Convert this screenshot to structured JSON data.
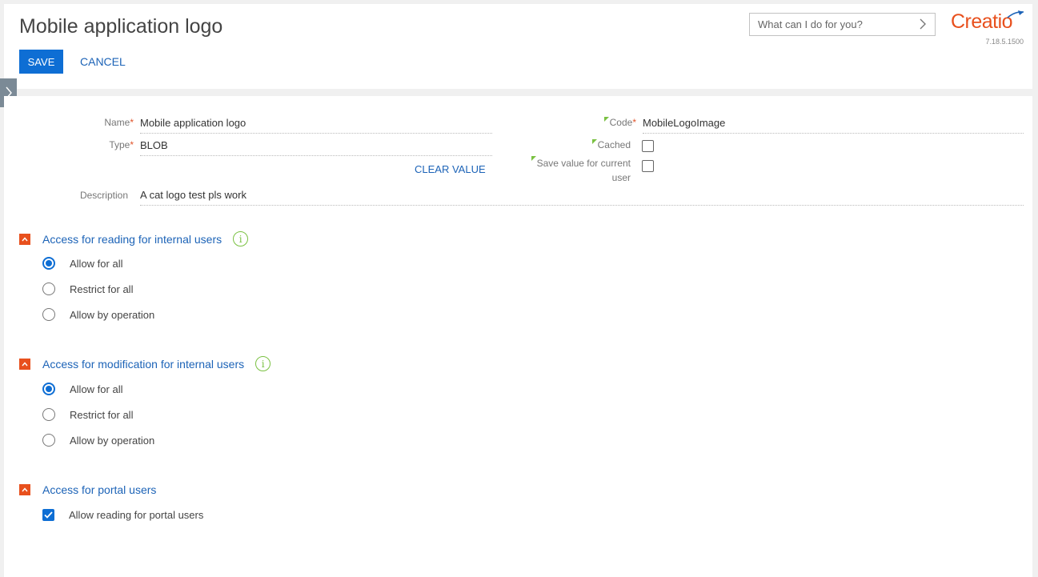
{
  "header": {
    "title": "Mobile application logo",
    "save_label": "SAVE",
    "cancel_label": "CANCEL",
    "search_placeholder": "What can I do for you?",
    "logo_text": "Creatio",
    "version": "7.18.5.1500"
  },
  "form": {
    "name_label": "Name",
    "name_value": "Mobile application logo",
    "type_label": "Type",
    "type_value": "BLOB",
    "clear_value_label": "CLEAR VALUE",
    "description_label": "Description",
    "description_value": "A cat logo test pls work",
    "code_label": "Code",
    "code_value": "MobileLogoImage",
    "cached_label": "Cached",
    "cached_checked": false,
    "save_current_user_label_1": "Save value for current",
    "save_current_user_label_2": "user",
    "save_current_user_checked": false,
    "required_mark": "*"
  },
  "sections": {
    "reading": {
      "title": "Access for reading for internal users",
      "options": [
        "Allow for all",
        "Restrict for all",
        "Allow by operation"
      ],
      "selected": 0
    },
    "modification": {
      "title": "Access for modification for internal users",
      "options": [
        "Allow for all",
        "Restrict for all",
        "Allow by operation"
      ],
      "selected": 0
    },
    "portal": {
      "title": "Access for portal users",
      "checkbox_label": "Allow reading for portal users",
      "checked": true
    }
  },
  "colors": {
    "accent_blue": "#0e6ed4",
    "link_blue": "#1c63b7",
    "brand_orange": "#e8501d",
    "info_green": "#7ac142"
  },
  "icons": {
    "search_chevron": "chevron-right-icon",
    "side_toggle": "chevron-right-icon",
    "collapse": "chevron-up-icon",
    "info": "info-circle-icon",
    "check": "checkmark-icon"
  }
}
